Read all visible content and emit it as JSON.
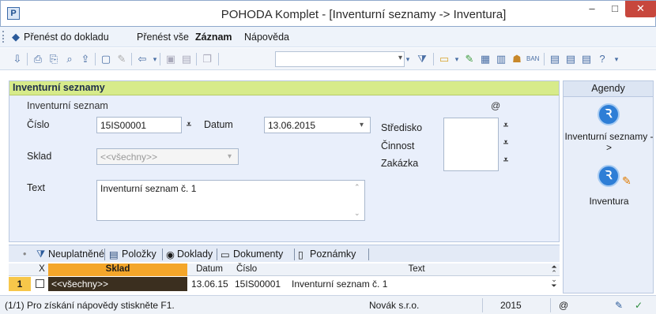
{
  "window": {
    "title": "POHODA Komplet - [Inventurní seznamy -> Inventura]",
    "minimize": "–",
    "maximize": "□",
    "close": "✕"
  },
  "menu": {
    "items": [
      "Přenést do dokladu",
      "Přenést vše",
      "Záznam",
      "Nápověda"
    ]
  },
  "toolbar": {
    "icons": [
      "import-icon",
      "print-icon",
      "print-preview-icon",
      "export-icon",
      "new-record-icon",
      "edit-icon",
      "back-icon",
      "save-icon",
      "save-copy-icon",
      "copy-icon",
      "filter-icon",
      "folder-icon",
      "attach-icon",
      "calculator-icon",
      "document-icon",
      "users-icon",
      "bank-icon",
      "list-icon",
      "list2-icon",
      "help-icon"
    ]
  },
  "panel": {
    "header": "Inventurní seznamy",
    "group_label": "Inventurní seznam",
    "at_sign": "@",
    "cislo_label": "Číslo",
    "cislo_value": "15IS00001",
    "datum_label": "Datum",
    "datum_value": "13.06.2015",
    "sklad_label": "Sklad",
    "sklad_value": "<<všechny>>",
    "text_label": "Text",
    "text_value": "Inventurní seznam č. 1",
    "stredisko_label": "Středisko",
    "cinnost_label": "Činnost",
    "zakazka_label": "Zakázka"
  },
  "agendy": {
    "header": "Agendy",
    "item1_label": "Inventurní seznamy ->",
    "item2_label": "Inventura"
  },
  "tabs": {
    "items": [
      "Neuplatněné",
      "Položky",
      "Doklady",
      "Dokumenty",
      "Poznámky"
    ]
  },
  "grid": {
    "headers": {
      "x": "X",
      "sklad": "Sklad",
      "datum": "Datum",
      "cislo": "Číslo",
      "text": "Text"
    },
    "row": {
      "num": "1",
      "sklad": "<<všechny>>",
      "datum": "13.06.15",
      "cislo": "15IS00001",
      "text": "Inventurní seznam č. 1"
    }
  },
  "status": {
    "help": "(1/1) Pro získání nápovědy stiskněte F1.",
    "company": "Novák s.r.o.",
    "year": "2015",
    "at": "@"
  },
  "colors": {
    "panel_header": "#d7eb8a",
    "sklad_header": "#f4a62a",
    "close_button": "#c7473d"
  }
}
